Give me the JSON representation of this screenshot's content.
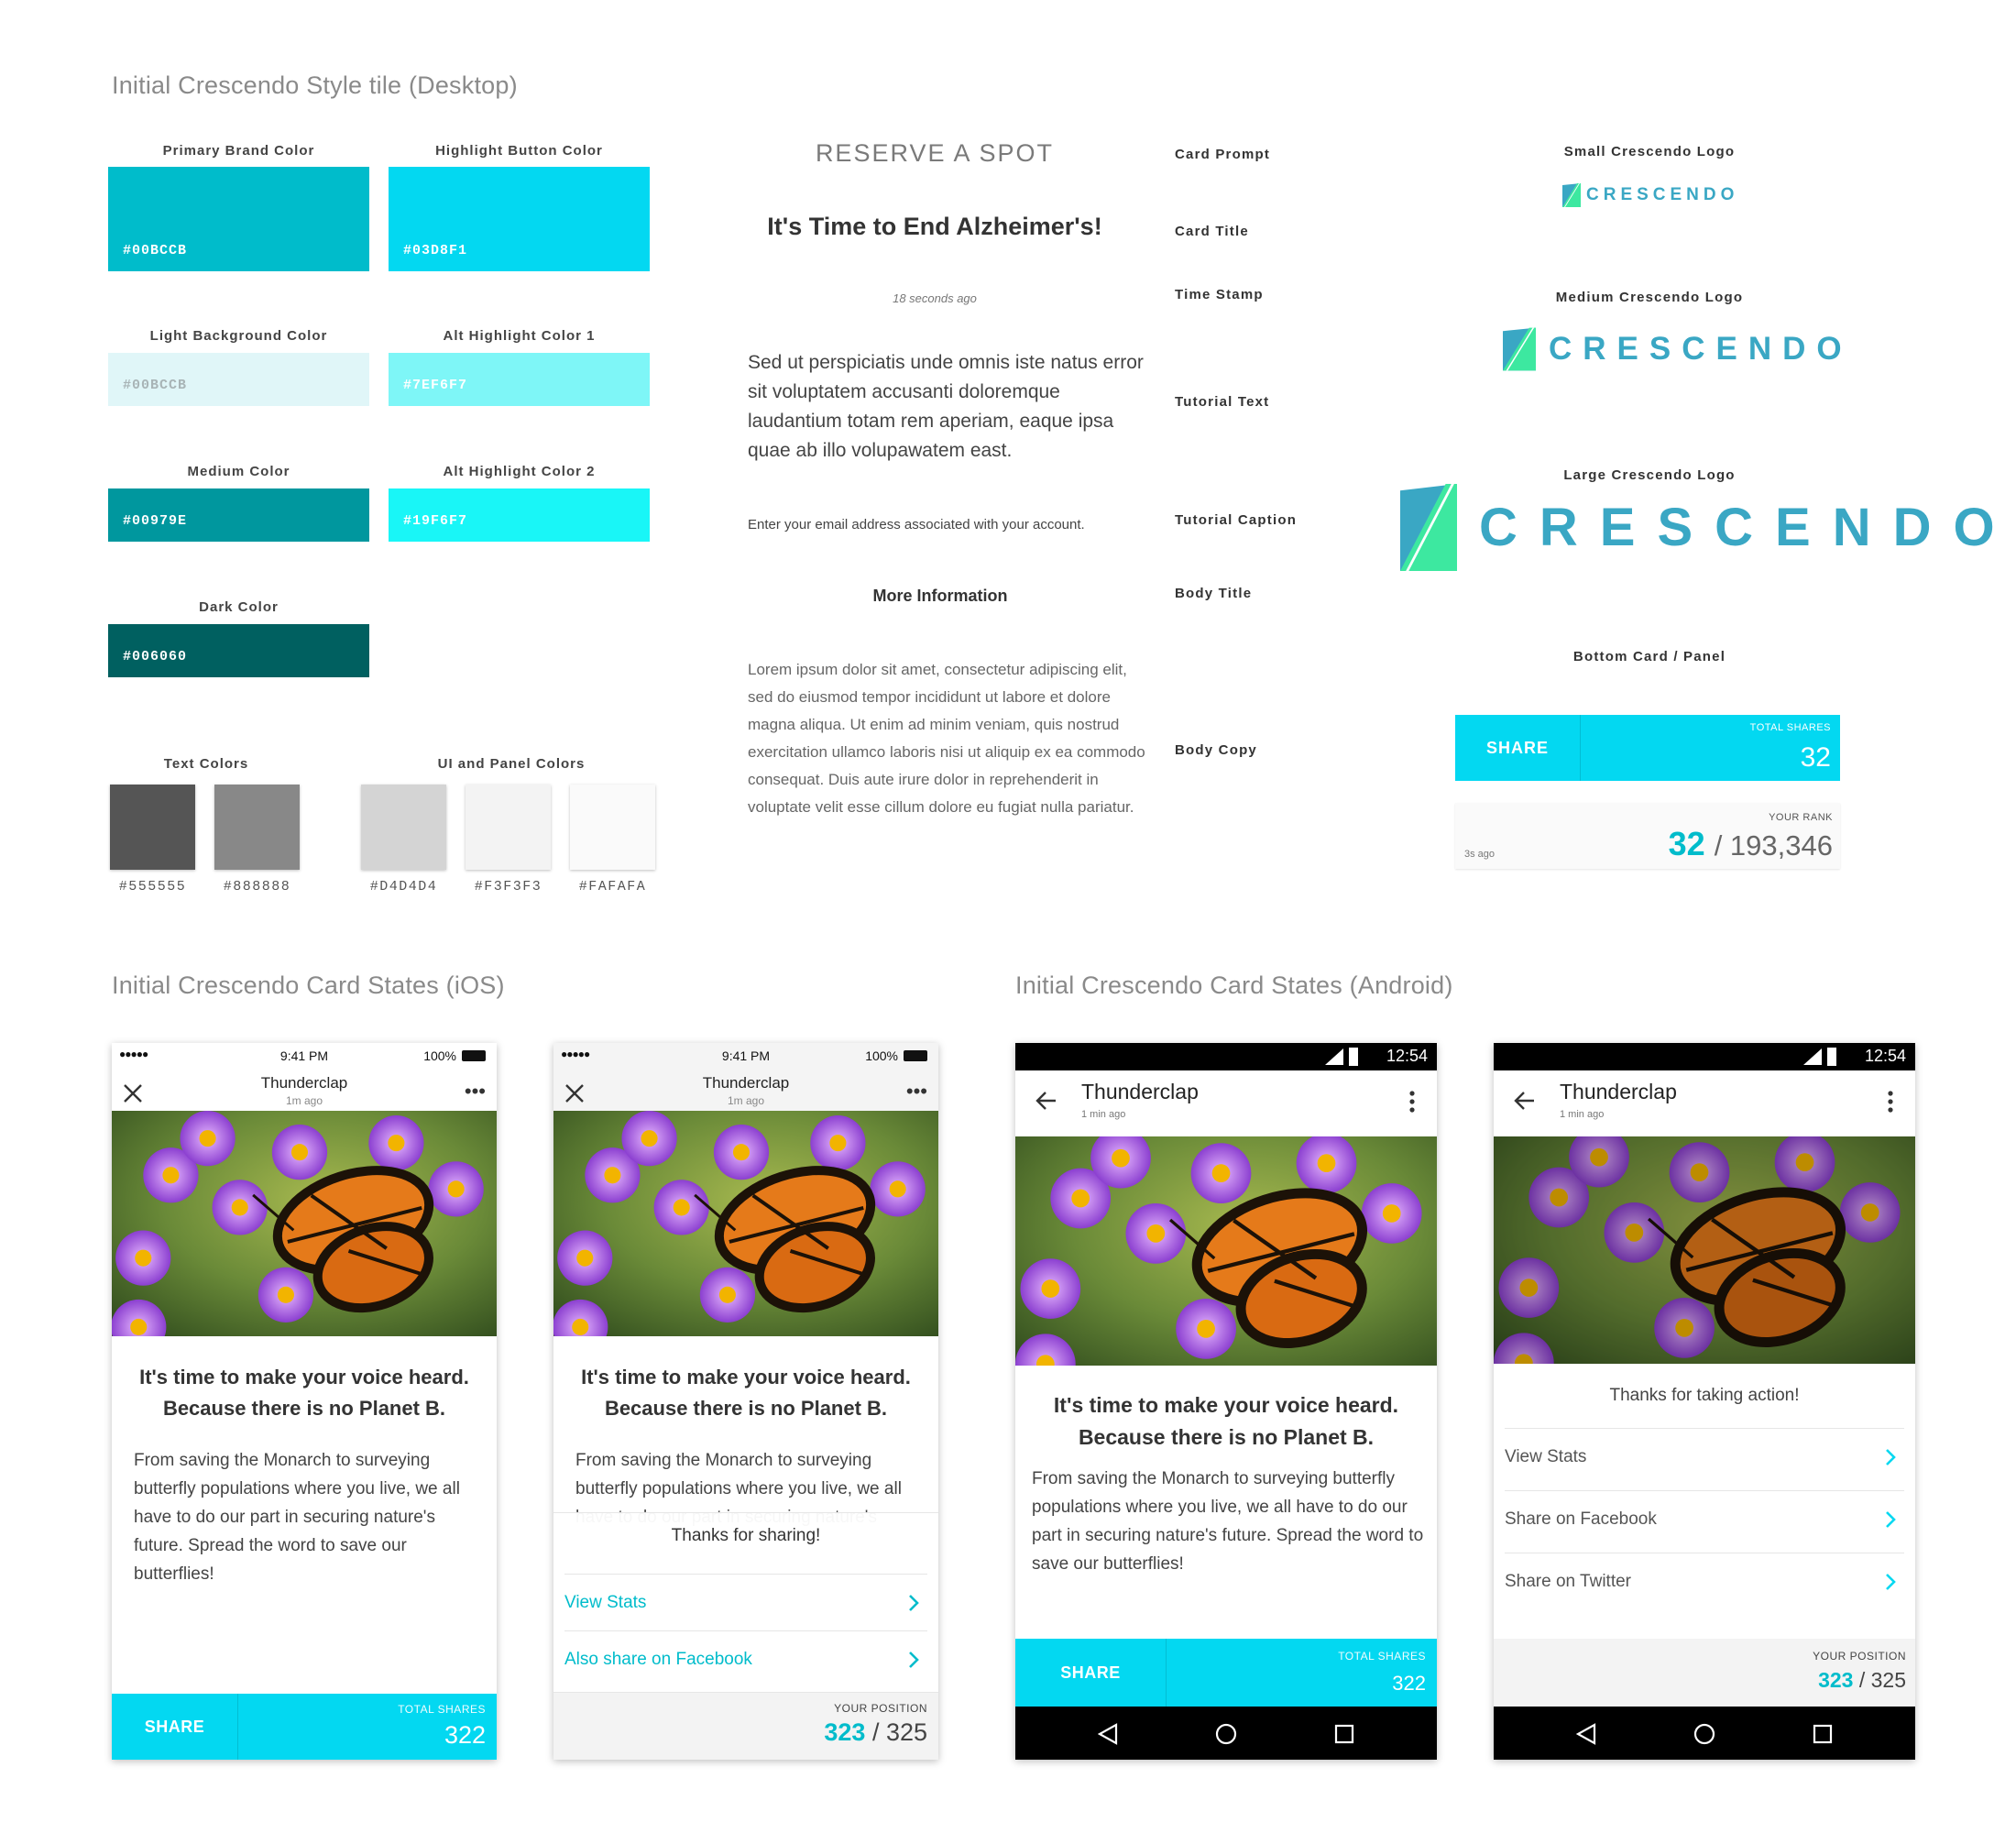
{
  "section_titles": {
    "style_tile": "Initial Crescendo Style tile  (Desktop)",
    "ios": "Initial Crescendo Card States (iOS)",
    "android": "Initial Crescendo Card States (Android)"
  },
  "swatches": [
    {
      "label": "Primary Brand Color",
      "hex": "#00BCCB",
      "color": "#00BCCB"
    },
    {
      "label": "Highlight Button Color",
      "hex": "#03D8F1",
      "color": "#03D8F1"
    },
    {
      "label": "Light Background Color",
      "hex": "#00BCCB",
      "color": "#E0F6F8"
    },
    {
      "label": "Alt Highlight Color 1",
      "hex": "#7EF6F7",
      "color": "#7EF6F7"
    },
    {
      "label": "Medium Color",
      "hex": "#00979E",
      "color": "#00979E"
    },
    {
      "label": "Alt Highlight Color 2",
      "hex": "#19F6F7",
      "color": "#19F6F7"
    },
    {
      "label": "Dark Color",
      "hex": "#006060",
      "color": "#006060"
    }
  ],
  "text_colors": {
    "label": "Text Colors",
    "items": [
      {
        "hex": "#555555",
        "color": "#555555"
      },
      {
        "hex": "#888888",
        "color": "#888888"
      }
    ]
  },
  "panel_colors": {
    "label": "UI and Panel Colors",
    "items": [
      {
        "hex": "#D4D4D4",
        "color": "#D4D4D4"
      },
      {
        "hex": "#F3F3F3",
        "color": "#F3F3F3"
      },
      {
        "hex": "#FAFAFA",
        "color": "#FAFAFA"
      }
    ]
  },
  "typography": {
    "card_prompt": {
      "sample": "RESERVE A SPOT",
      "label": "Card Prompt"
    },
    "card_title": {
      "sample": "It's Time to End Alzheimer's!",
      "label": "Card Title"
    },
    "time_stamp": {
      "sample": "18 seconds ago",
      "label": "Time Stamp"
    },
    "tutorial_text": {
      "sample": "Sed ut perspiciatis unde omnis iste natus error sit voluptatem accusanti doloremque laudantium totam rem aperiam, eaque ipsa quae ab illo volupawatem east.",
      "label": "Tutorial Text"
    },
    "tutorial_caption": {
      "sample": "Enter your email address associated with your account.",
      "label": "Tutorial Caption"
    },
    "body_title": {
      "sample": "More Information",
      "label": "Body Title"
    },
    "body_copy": {
      "sample": "Lorem ipsum dolor sit amet, consectetur adipiscing elit, sed do eiusmod tempor incididunt ut labore et dolore magna aliqua. Ut enim ad minim veniam, quis nostrud exercitation ullamco laboris nisi ut aliquip ex ea commodo consequat. Duis aute irure dolor in reprehenderit in voluptate velit esse cillum dolore eu fugiat nulla pariatur.",
      "label": "Body Copy"
    }
  },
  "logos": {
    "small_label": "Small Crescendo Logo",
    "medium_label": "Medium Crescendo Logo",
    "large_label": "Large Crescendo Logo",
    "wordmark": "CRESCENDO"
  },
  "bottom_panel": {
    "label": "Bottom Card / Panel",
    "share": "SHARE",
    "total_label": "TOTAL SHARES",
    "total_value": "32",
    "rank_label": "YOUR RANK",
    "rank_time": "3s ago",
    "rank_value": "32",
    "rank_total": "/ 193,346"
  },
  "ios": {
    "status": {
      "time": "9:41 PM",
      "battery": "100%",
      "signal": "●●●●●"
    },
    "title": "Thunderclap",
    "subtitle": "1m ago",
    "more": "•••",
    "heading_1": "It's time to make your voice heard.",
    "heading_2": "Because there is no Planet B.",
    "body": "From saving the Monarch to surveying butterfly populations where you live, we all have to do our part in securing nature's future. Spread the word to save our butterflies!",
    "share": "SHARE",
    "total_label": "TOTAL SHARES",
    "total_value": "322",
    "thanks": "Thanks for sharing!",
    "view_stats": "View Stats",
    "share_facebook": "Also share on Facebook",
    "position_label": "YOUR POSITION",
    "position_value": "323",
    "position_total": "/ 325"
  },
  "android": {
    "status_time": "12:54",
    "title": "Thunderclap",
    "subtitle": "1 min ago",
    "heading_1": "It's time to make your voice heard.",
    "heading_2": "Because there is no Planet B.",
    "body": "From saving the Monarch to surveying butterfly populations where you live, we all have to do our part in securing nature's future. Spread the word to save our butterflies!",
    "share": "SHARE",
    "total_label": "TOTAL SHARES",
    "total_value": "322",
    "thanks": "Thanks for taking action!",
    "view_stats": "View Stats",
    "share_facebook": "Share on Facebook",
    "share_twitter": "Share on Twitter",
    "position_label": "YOUR POSITION",
    "position_value": "323",
    "position_total": "/ 325"
  },
  "colors": {
    "accent": "#03D8F1",
    "brand": "#00BCCB",
    "link": "#00BCCB",
    "logo_text": "#3AA7C4",
    "logo_mark": "#3DE8A0"
  }
}
